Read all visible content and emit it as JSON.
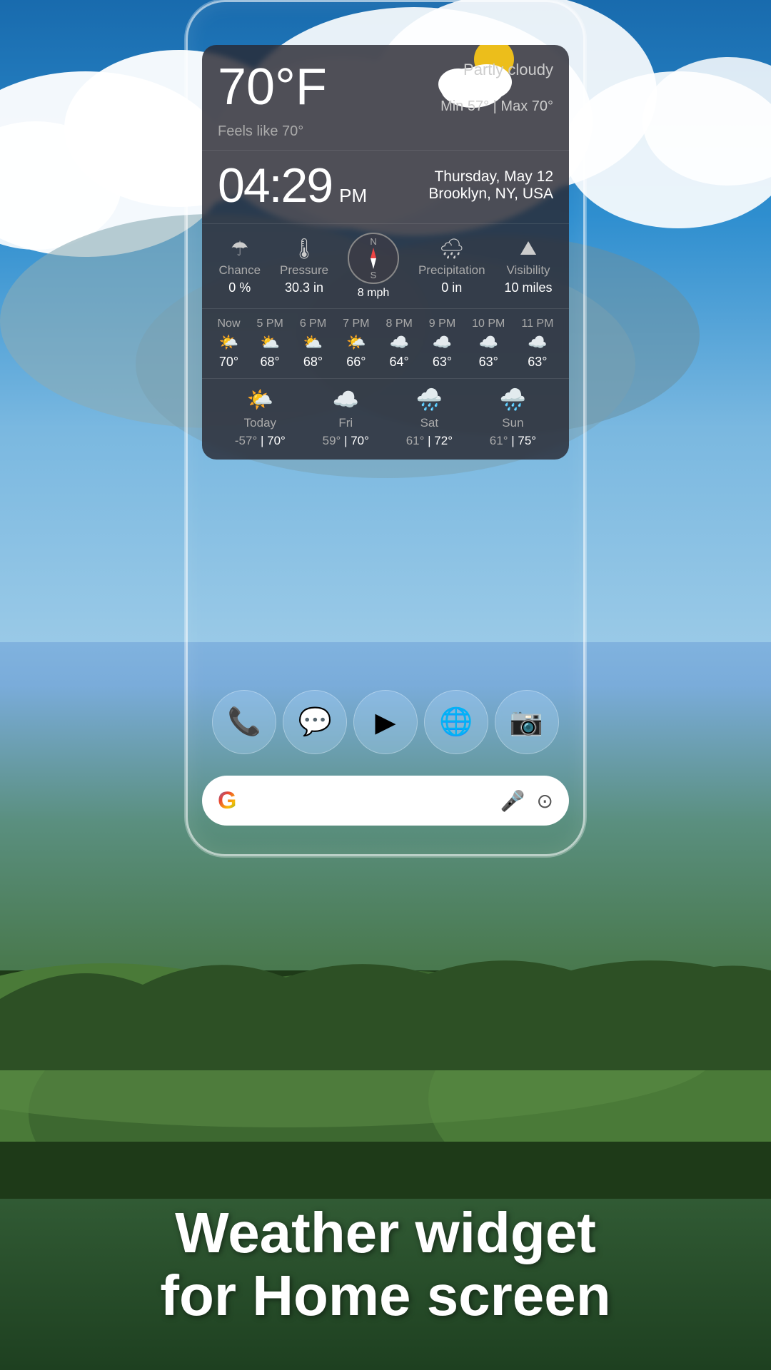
{
  "background": {
    "sky_top": "#1a6bb5",
    "sky_bottom": "#6ab0e0"
  },
  "weather_widget": {
    "temperature": "70°F",
    "condition": "Partly cloudy",
    "feels_like": "Feels like  70°",
    "min_temp": "Min 57°",
    "max_temp": "Max 70°",
    "time": "04:29",
    "ampm": "PM",
    "date": "Thursday, May 12",
    "location": "Brooklyn, NY, USA",
    "stats": {
      "chance_label": "Chance",
      "chance_value": "0 %",
      "pressure_label": "Pressure",
      "pressure_value": "30.3 in",
      "wind_value": "8",
      "wind_unit": "mph",
      "precip_label": "Precipitation",
      "precip_value": "0 in",
      "visibility_label": "Visibility",
      "visibility_value": "10 miles"
    },
    "hourly": [
      {
        "label": "Now",
        "temp": "70°",
        "icon": "🌤️"
      },
      {
        "label": "5 PM",
        "temp": "68°",
        "icon": "⛅"
      },
      {
        "label": "6 PM",
        "temp": "68°",
        "icon": "⛅"
      },
      {
        "label": "7 PM",
        "temp": "66°",
        "icon": "🌤️"
      },
      {
        "label": "8 PM",
        "temp": "64°",
        "icon": "☁️"
      },
      {
        "label": "9 PM",
        "temp": "63°",
        "icon": "☁️"
      },
      {
        "label": "10 PM",
        "temp": "63°",
        "icon": "☁️"
      },
      {
        "label": "11 PM",
        "temp": "63°",
        "icon": "☁️"
      }
    ],
    "daily": [
      {
        "label": "Today",
        "icon": "🌤️",
        "low": "-57°",
        "high": "70°"
      },
      {
        "label": "Fri",
        "icon": "☁️",
        "low": "59°",
        "high": "70°"
      },
      {
        "label": "Sat",
        "icon": "🌧️",
        "low": "61°",
        "high": "72°"
      },
      {
        "label": "Sun",
        "icon": "🌧️",
        "low": "61°",
        "high": "75°"
      }
    ]
  },
  "dock": {
    "icons": [
      {
        "name": "phone",
        "symbol": "📞"
      },
      {
        "name": "messages",
        "symbol": "💬"
      },
      {
        "name": "play-store",
        "symbol": "▶"
      },
      {
        "name": "chrome",
        "symbol": "🌐"
      },
      {
        "name": "camera",
        "symbol": "📷"
      }
    ]
  },
  "search_bar": {
    "placeholder": "",
    "logo": "G",
    "mic_icon": "🎤",
    "lens_icon": "🔍"
  },
  "tagline": {
    "line1": "Weather widget",
    "line2": "for Home screen"
  }
}
